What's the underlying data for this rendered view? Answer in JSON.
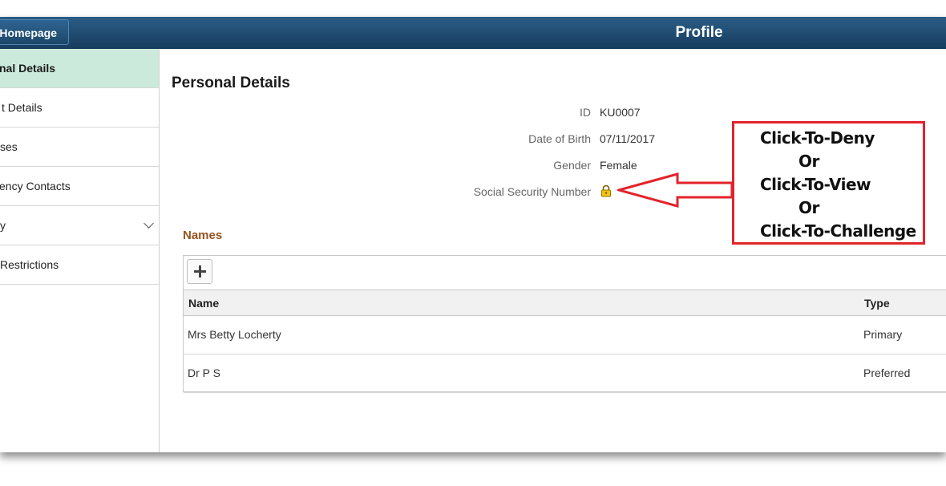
{
  "header": {
    "home_button_label": "Homepage",
    "page_title": "Profile",
    "background_color": "#1f4b72"
  },
  "sidebar": {
    "items": [
      {
        "label": "nal Details",
        "active": true
      },
      {
        "label": "t Details",
        "active": false
      },
      {
        "label": "ses",
        "active": false
      },
      {
        "label": "ency Contacts",
        "active": false
      },
      {
        "label": "y",
        "active": false,
        "expandable": true
      },
      {
        "label": " Restrictions",
        "active": false
      }
    ],
    "active_color": "#cbeadb"
  },
  "main": {
    "section_title": "Personal Details",
    "fields": [
      {
        "label": "ID",
        "value": "KU0007"
      },
      {
        "label": "Date of Birth",
        "value": "07/11/2017"
      },
      {
        "label": "Gender",
        "value": "Female"
      },
      {
        "label": "Social Security Number",
        "icon": "lock-icon"
      }
    ],
    "names": {
      "heading": "Names",
      "heading_color": "#96531c",
      "add_icon": "plus-icon",
      "columns": [
        "Name",
        "Type"
      ],
      "rows": [
        {
          "name": "Mrs Betty Locherty",
          "type": "Primary"
        },
        {
          "name": "Dr P S",
          "type": "Preferred"
        }
      ]
    }
  },
  "annotation": {
    "lines": [
      "Click-To-Deny",
      "Or",
      "Click-To-View",
      "Or",
      "Click-To-Challenge"
    ],
    "color": "#e3232b",
    "icon": "left-arrow-icon"
  }
}
